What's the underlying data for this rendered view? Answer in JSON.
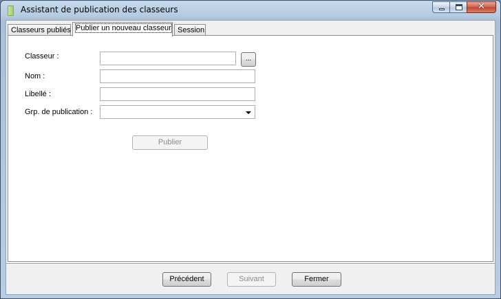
{
  "window": {
    "title": "Assistant de publication des classeurs",
    "icon": "app-icon",
    "controls": {
      "minimize": "minimize-icon",
      "maximize": "maximize-icon",
      "close": "✕"
    }
  },
  "tabs": [
    {
      "label": "Classeurs publiés",
      "active": false
    },
    {
      "label": "Publier un nouveau classeur",
      "active": true
    },
    {
      "label": "Session",
      "active": false
    }
  ],
  "form": {
    "classeur": {
      "label": "Classeur :",
      "value": "",
      "browse_label": "..."
    },
    "nom": {
      "label": "Nom :",
      "value": ""
    },
    "libelle": {
      "label": "Libellé :",
      "value": ""
    },
    "groupe": {
      "label": "Grp. de publication :",
      "selected": ""
    },
    "publish_label": "Publier"
  },
  "footer": {
    "previous_label": "Précédent",
    "next_label": "Suivant",
    "close_label": "Fermer"
  }
}
